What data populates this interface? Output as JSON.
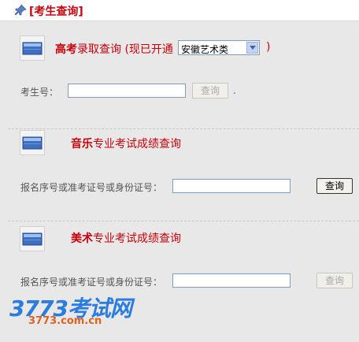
{
  "header": {
    "title": "[考生查询]"
  },
  "gaokao": {
    "title_prefix": "高考",
    "title_main": "录取查询 (现已开通",
    "select_value": "安徽艺术类",
    "title_suffix": ")",
    "field_label": "考生号：",
    "button_label": "查询",
    "trailing_dot": "."
  },
  "music": {
    "title_prefix": "音乐",
    "title_main": "专业考试成绩查询",
    "field_label": "报名序号或准考证号或身份证号：",
    "button_label": "查询"
  },
  "art": {
    "title_prefix": "美术",
    "title_main": "专业考试成绩查询",
    "field_label": "报名序号或准考证号或身份证号：",
    "button_label": "查询"
  },
  "watermark": {
    "main": "3773考试网",
    "sub": "3773.com.cn"
  },
  "colors": {
    "accent_red": "#c8000a",
    "watermark_blue": "#2a7ce0",
    "watermark_orange": "#e0601e"
  }
}
